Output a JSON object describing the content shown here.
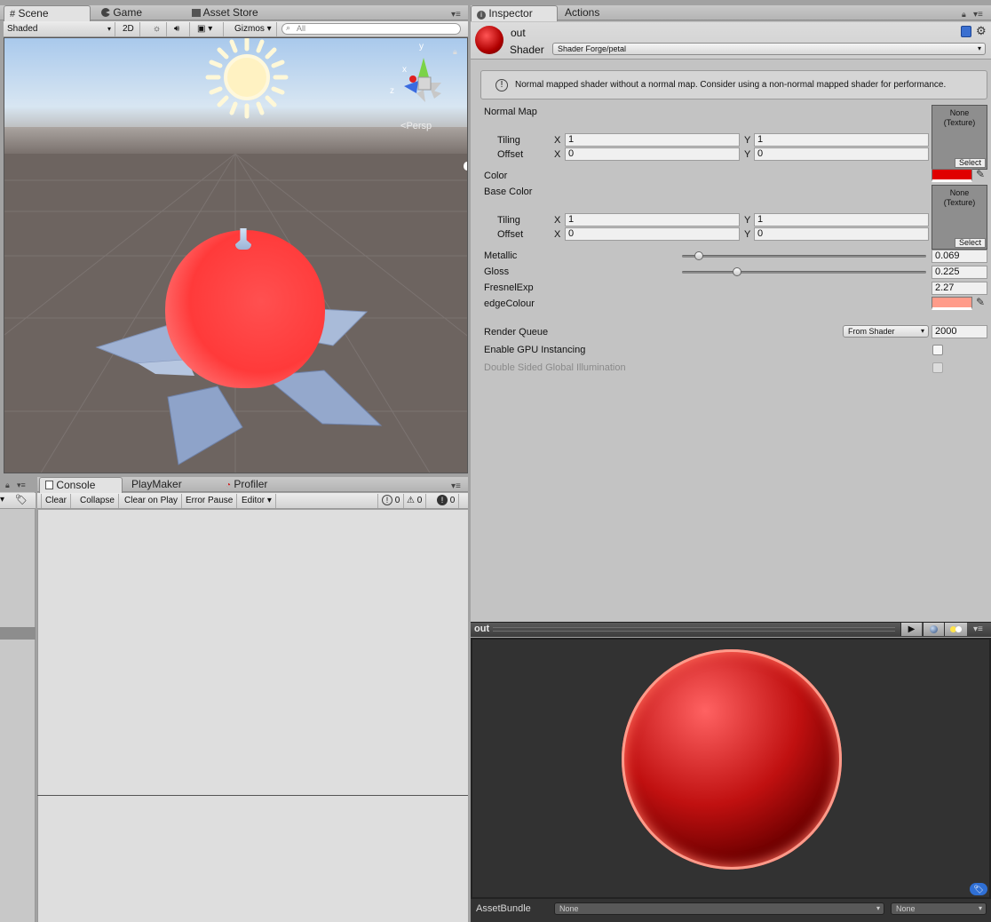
{
  "scene_panel": {
    "tabs": [
      {
        "label": "Scene",
        "icon": "grid-icon"
      },
      {
        "label": "Game",
        "icon": "pacman-icon"
      },
      {
        "label": "Asset Store",
        "icon": "store-icon"
      }
    ],
    "toolbar": {
      "draw_mode": "Shaded",
      "mode_2d": "2D",
      "gizmos": "Gizmos",
      "search_placeholder": "All"
    },
    "gizmo": {
      "y": "y",
      "x": "x",
      "z": "z",
      "projection": "Persp"
    }
  },
  "console_panel": {
    "tabs": [
      {
        "label": "Console",
        "icon": "console-icon"
      },
      {
        "label": "PlayMaker"
      },
      {
        "label": "Profiler",
        "icon": "profiler-icon"
      }
    ],
    "toolbar": {
      "clear": "Clear",
      "collapse": "Collapse",
      "clear_on_play": "Clear on Play",
      "error_pause": "Error Pause",
      "editor": "Editor",
      "info_count": "0",
      "warning_count": "0",
      "error_count": "0"
    }
  },
  "inspector": {
    "tabs": [
      {
        "label": "Inspector",
        "icon": "info-icon"
      },
      {
        "label": "Actions"
      }
    ],
    "material_name": "out",
    "shader_label": "Shader",
    "shader_value": "Shader Forge/petal",
    "help_message": "Normal mapped shader without a normal map. Consider using a non-normal mapped shader for performance.",
    "normal_map": {
      "label": "Normal Map",
      "tiling_label": "Tiling",
      "offset_label": "Offset",
      "tiling_x": "1",
      "tiling_y": "1",
      "offset_x": "0",
      "offset_y": "0",
      "texture_line1": "None",
      "texture_line2": "(Texture)",
      "select": "Select"
    },
    "color": {
      "label": "Color",
      "value": "#e00000"
    },
    "base_color": {
      "label": "Base Color",
      "tiling_label": "Tiling",
      "offset_label": "Offset",
      "tiling_x": "1",
      "tiling_y": "1",
      "offset_x": "0",
      "offset_y": "0",
      "texture_line1": "None",
      "texture_line2": "(Texture)",
      "select": "Select"
    },
    "axis_x": "X",
    "axis_y": "Y",
    "metallic": {
      "label": "Metallic",
      "value": "0.069",
      "fraction": 0.069
    },
    "gloss": {
      "label": "Gloss",
      "value": "0.225",
      "fraction": 0.225
    },
    "fresnel": {
      "label": "FresnelExp",
      "value": "2.27"
    },
    "edge_colour": {
      "label": "edgeColour",
      "value": "#ff9c8a"
    },
    "render_queue": {
      "label": "Render Queue",
      "mode": "From Shader",
      "value": "2000"
    },
    "gpu_instancing": {
      "label": "Enable GPU Instancing",
      "checked": false
    },
    "double_sided_gi": {
      "label": "Double Sided Global Illumination",
      "checked": false
    }
  },
  "preview": {
    "title": "out",
    "asset_bundle_label": "AssetBundle",
    "bundle_value": "None",
    "variant_value": "None"
  },
  "colors": {
    "apple": "#ff3b3b",
    "petal": "#9fb2d4",
    "sky": "#c9dff5",
    "ground": "#6d6460",
    "preview_bg": "#323232"
  }
}
